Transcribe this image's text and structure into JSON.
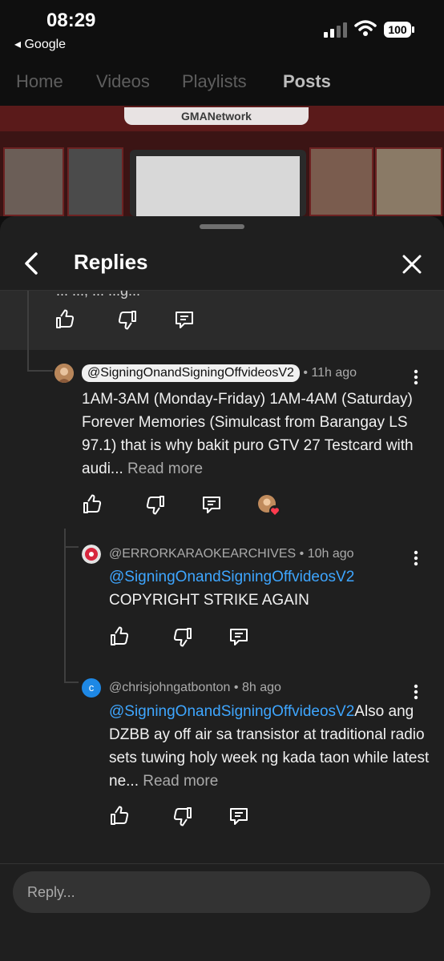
{
  "status_bar": {
    "time": "08:29",
    "back_app": "◂ Google",
    "battery": "100"
  },
  "channel_tabs": [
    "Home",
    "Videos",
    "Playlists",
    "Posts"
  ],
  "banner": {
    "logo_text": "GMANetwork"
  },
  "sheet": {
    "title": "Replies",
    "parent_cut_text": "... ..., ... ...g..."
  },
  "replies": [
    {
      "author": "@SigningOnandSigningOffvideosV2",
      "time": "• 11h ago",
      "text": "1AM-3AM (Monday-Friday) 1AM-4AM (Saturday) Forever Memories (Simulcast from Barangay LS 97.1) that is why bakit puro GTV 27 Testcard with audi...",
      "read_more": "Read more"
    },
    {
      "author": "@ERRORKARAOKEARCHIVES",
      "time": "• 10h ago",
      "mention": "@SigningOnandSigningOffvideosV2",
      "text": "COPYRIGHT STRIKE AGAIN"
    },
    {
      "author": "@chrisjohngatbonton",
      "time": "• 8h ago",
      "avatar_letter": "c",
      "mention": "@SigningOnandSigningOffvideosV2",
      "text": "Also ang DZBB ay off air sa transistor at traditional radio sets tuwing holy week ng kada taon while latest ne...",
      "read_more": "Read more"
    }
  ],
  "reply_box": {
    "placeholder": "Reply..."
  },
  "colors": {
    "background": "#0f0f0f",
    "sheet": "#1f1f1f",
    "mention": "#3ea6ff",
    "heart": "#ff3b4e"
  },
  "icons": [
    "back-icon",
    "close-icon",
    "like-icon",
    "dislike-icon",
    "reply-icon",
    "kebab-icon",
    "heart-icon",
    "signal-icon",
    "wifi-icon",
    "battery-icon"
  ]
}
